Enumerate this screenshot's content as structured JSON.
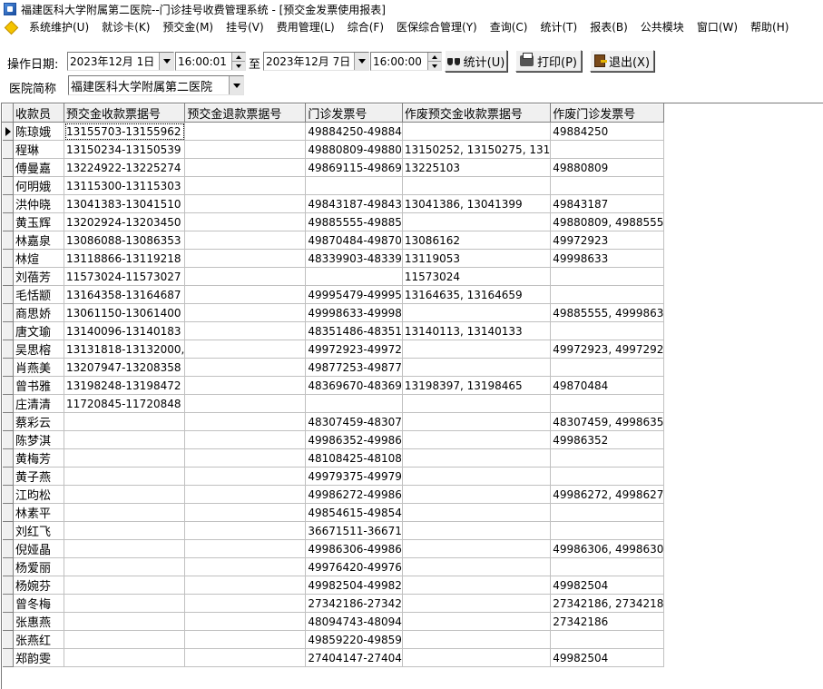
{
  "window": {
    "title": "福建医科大学附属第二医院--门诊挂号收费管理系统 - [预交金发票使用报表]"
  },
  "menu": [
    "系统维护(U)",
    "就诊卡(K)",
    "预交金(M)",
    "挂号(V)",
    "费用管理(L)",
    "综合(F)",
    "医保综合管理(Y)",
    "查询(C)",
    "统计(T)",
    "报表(B)",
    "公共模块",
    "窗口(W)",
    "帮助(H)"
  ],
  "filters": {
    "date_label": "操作日期:",
    "start_date": "2023年12月 1日",
    "start_time": "16:00:01",
    "to_label": "至",
    "end_date": "2023年12月 7日",
    "end_time": "16:00:00",
    "hospital_label": "医院简称",
    "hospital_value": "福建医科大学附属第二医院"
  },
  "buttons": {
    "stats": "统计(U)",
    "print": "打印(P)",
    "exit": "退出(X)"
  },
  "table": {
    "columns": [
      "收款员",
      "预交金收款票据号",
      "预交金退款票据号",
      "门诊发票号",
      "作废预交金收款票据号",
      "作废门诊发票号"
    ],
    "rows": [
      [
        "陈琼娥",
        "13155703-13155962",
        "",
        "49884250-49884",
        "",
        "49884250"
      ],
      [
        "程琳",
        "13150234-13150539",
        "",
        "49880809-49880",
        "13150252, 13150275, 131",
        ""
      ],
      [
        "傅曼嘉",
        "13224922-13225274",
        "",
        "49869115-49869",
        "13225103",
        "49880809"
      ],
      [
        "何明娥",
        "13115300-13115303",
        "",
        "",
        "",
        ""
      ],
      [
        "洪仲晓",
        "13041383-13041510",
        "",
        "49843187-49843",
        "13041386, 13041399",
        "49843187"
      ],
      [
        "黄玉辉",
        "13202924-13203450",
        "",
        "49885555-49885",
        "",
        "49880809, 4988555"
      ],
      [
        "林嘉泉",
        "13086088-13086353",
        "",
        "49870484-49870",
        "13086162",
        "49972923"
      ],
      [
        "林煊",
        "13118866-13119218",
        "",
        "48339903-48339",
        "13119053",
        "49998633"
      ],
      [
        "刘蓓芳",
        "11573024-11573027",
        "",
        "",
        "11573024",
        ""
      ],
      [
        "毛恬颛",
        "13164358-13164687",
        "",
        "49995479-49995",
        "13164635, 13164659",
        ""
      ],
      [
        "商思娇",
        "13061150-13061400",
        "",
        "49998633-49998",
        "",
        "49885555, 4999863"
      ],
      [
        "唐文瑜",
        "13140096-13140183",
        "",
        "48351486-48351",
        "13140113, 13140133",
        ""
      ],
      [
        "吴思榕",
        "13131818-13132000,",
        "",
        "49972923-49972",
        "",
        "49972923, 4997292"
      ],
      [
        "肖燕美",
        "13207947-13208358",
        "",
        "49877253-49877",
        "",
        ""
      ],
      [
        "曾书雅",
        "13198248-13198472",
        "",
        "48369670-48369",
        "13198397, 13198465",
        "49870484"
      ],
      [
        "庄清清",
        "11720845-11720848",
        "",
        "",
        "",
        ""
      ],
      [
        "蔡彩云",
        "",
        "",
        "48307459-48307",
        "",
        "48307459, 4998635"
      ],
      [
        "陈梦淇",
        "",
        "",
        "49986352-49986",
        "",
        "49986352"
      ],
      [
        "黄梅芳",
        "",
        "",
        "48108425-48108",
        "",
        ""
      ],
      [
        "黄子燕",
        "",
        "",
        "49979375-49979",
        "",
        ""
      ],
      [
        "江昀松",
        "",
        "",
        "49986272-49986",
        "",
        "49986272, 4998627"
      ],
      [
        "林素平",
        "",
        "",
        "49854615-49854",
        "",
        ""
      ],
      [
        "刘红飞",
        "",
        "",
        "36671511-36671",
        "",
        ""
      ],
      [
        "倪娅晶",
        "",
        "",
        "49986306-49986",
        "",
        "49986306, 4998630"
      ],
      [
        "杨爱丽",
        "",
        "",
        "49976420-49976",
        "",
        ""
      ],
      [
        "杨婉芬",
        "",
        "",
        "49982504-49982",
        "",
        "49982504"
      ],
      [
        "曾冬梅",
        "",
        "",
        "27342186-27342",
        "",
        "27342186, 2734218"
      ],
      [
        "张惠燕",
        "",
        "",
        "48094743-48094",
        "",
        "27342186"
      ],
      [
        "张燕红",
        "",
        "",
        "49859220-49859",
        "",
        ""
      ],
      [
        "郑韵雯",
        "",
        "",
        "27404147-27404",
        "",
        "49982504"
      ]
    ]
  }
}
